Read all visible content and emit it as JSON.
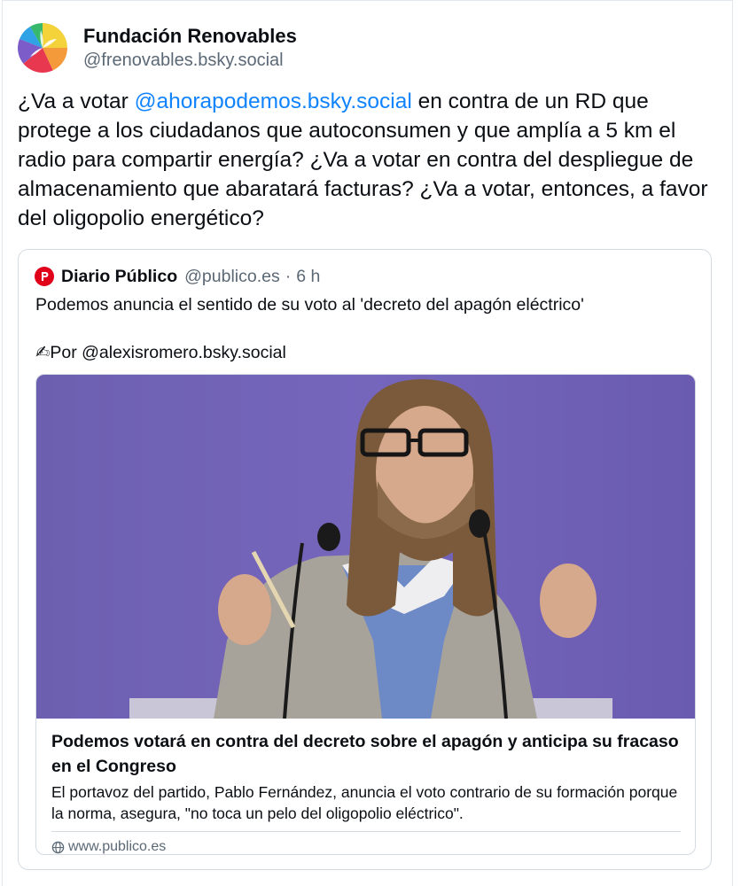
{
  "author": {
    "display_name": "Fundación Renovables",
    "handle": "@frenovables.bsky.social",
    "avatar_icon": "pinwheel-logo-icon"
  },
  "post": {
    "text_before": "¿Va a votar ",
    "mention": "@ahorapodemos.bsky.social",
    "text_after": " en contra de un RD que protege a los ciudadanos que autoconsumen y que amplía a 5 km el radio para compartir energía? ¿Va a votar en contra del despliegue de almacenamiento que abaratará facturas? ¿Va a votar, entonces, a favor del oligopolio energético?"
  },
  "embed": {
    "author_name": "Diario Público",
    "author_handle": "@publico.es",
    "separator": "·",
    "time": "6 h",
    "text": "Podemos anuncia el sentido de su voto al 'decreto del apagón eléctrico'",
    "byline": "✍Por @alexisromero.bsky.social",
    "card": {
      "title": "Podemos votará en contra del decreto sobre el apagón y anticipa su fracaso en el Congreso",
      "description": "El portavoz del partido, Pablo Fernández, anuncia el voto contrario de su formación porque la norma, asegura, \"no toca un pelo del oligopolio eléctrico\".",
      "domain": "www.publico.es",
      "domain_icon": "globe-icon"
    }
  },
  "colors": {
    "mention": "#1083fe",
    "muted": "#5b6875",
    "border": "#d4dbe2",
    "publico_red": "#e1001a"
  }
}
